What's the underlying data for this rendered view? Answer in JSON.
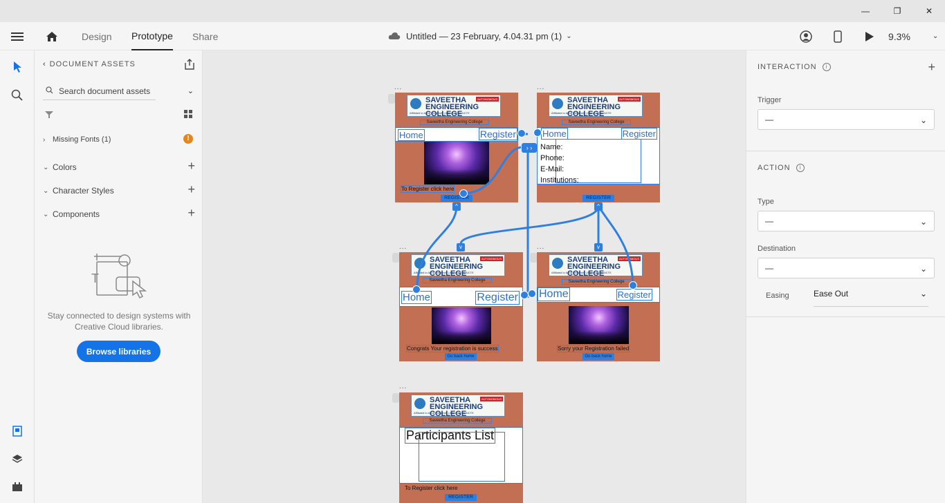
{
  "window": {
    "minimize": "—",
    "restore": "❐",
    "close": "✕"
  },
  "appbar": {
    "tabs": [
      "Design",
      "Prototype",
      "Share"
    ],
    "doc_title": "Untitled — 23 February, 4.04.31 pm (1)",
    "zoom": "9.3%"
  },
  "assets": {
    "title": "DOCUMENT ASSETS",
    "search_placeholder": "Search document assets",
    "missing_fonts": "Missing Fonts (1)",
    "sections": [
      "Colors",
      "Character Styles",
      "Components"
    ],
    "empty_message": "Stay connected to design systems with Creative Cloud libraries.",
    "browse_button": "Browse libraries"
  },
  "props": {
    "interaction_title": "INTERACTION",
    "trigger_label": "Trigger",
    "trigger_value": "—",
    "action_title": "ACTION",
    "type_label": "Type",
    "type_value": "—",
    "destination_label": "Destination",
    "destination_value": "—",
    "easing_label": "Easing",
    "easing_value": "Ease Out"
  },
  "artboards": {
    "college_name": "SAVEETHA ENGINEERING COLLEGE",
    "affiliation": "Affiliated to Anna University | Approved by AICTE",
    "autonomous": "AUTONOMOUS",
    "subtitle": "Saveetha Engineering College",
    "home": "Home",
    "register": "Register",
    "register_button": "REGISTER",
    "to_register": "To Register click here",
    "form_fields": [
      "Name:",
      "Phone:",
      "E-Mail:",
      "Institutions:"
    ],
    "success_msg": "Congrats Your registration is success",
    "failed_msg": "Sorry your Registration failed",
    "go_back": "Go back home",
    "participants": "Participants List",
    "dots": "..."
  },
  "colors": {
    "accent": "#2f7fe0",
    "artboard_bg": "#c26f53",
    "browse_button": "#1473e6"
  }
}
